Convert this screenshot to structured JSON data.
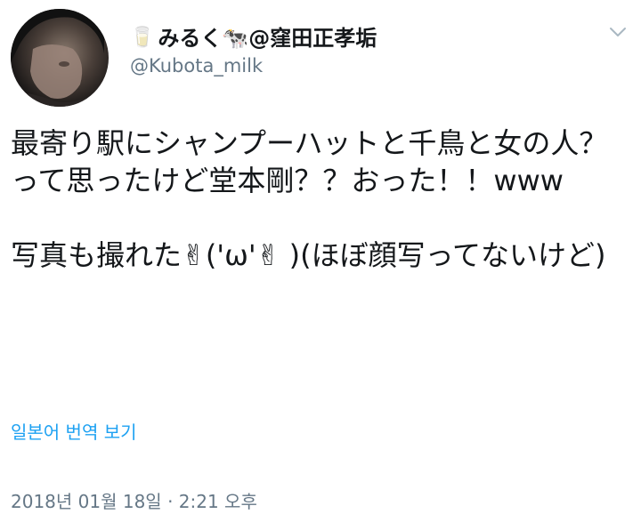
{
  "author": {
    "name_prefix_glyph": "🥛",
    "display_name": "みるく🐄@窪田正孝垢",
    "handle": "@Kubota_milk"
  },
  "tweet": {
    "text": "最寄り駅にシャンプーハットと千鳥と女の人？って思ったけど堂本剛？？おった！！www\n\n写真も撮れた✌('ω'✌ )(ほぼ顔写ってないけど)"
  },
  "actions": {
    "translate_label": "일본어 번역 보기"
  },
  "meta": {
    "timestamp": "2018년 01월 18일 · 2:21 오후"
  },
  "icons": {
    "menu": "chevron-down-icon",
    "avatar": "profile-photo"
  },
  "colors": {
    "link": "#1da1f2",
    "secondary_text": "#657786",
    "primary_text": "#14171a"
  }
}
